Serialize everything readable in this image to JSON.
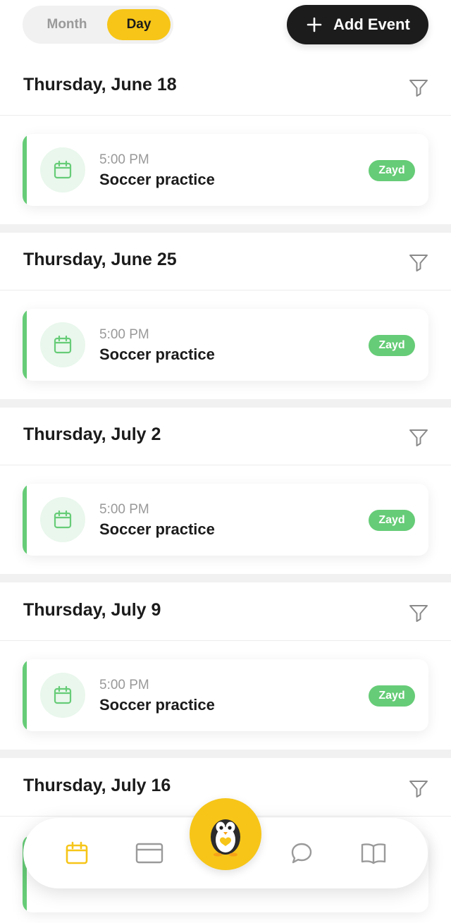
{
  "view_toggle": {
    "month_label": "Month",
    "day_label": "Day",
    "selected": "Day"
  },
  "add_event": {
    "label": "Add Event",
    "icon": "plus-icon"
  },
  "colors": {
    "accent_yellow": "#f6c518",
    "event_green": "#66cc77",
    "dark": "#1c1c1c",
    "muted": "#999999"
  },
  "days": [
    {
      "date": "Thursday, June 18",
      "events": [
        {
          "time": "5:00 PM",
          "title": "Soccer practice",
          "tag": "Zayd"
        }
      ]
    },
    {
      "date": "Thursday, June 25",
      "events": [
        {
          "time": "5:00 PM",
          "title": "Soccer practice",
          "tag": "Zayd"
        }
      ]
    },
    {
      "date": "Thursday, July 2",
      "events": [
        {
          "time": "5:00 PM",
          "title": "Soccer practice",
          "tag": "Zayd"
        }
      ]
    },
    {
      "date": "Thursday, July 9",
      "events": [
        {
          "time": "5:00 PM",
          "title": "Soccer practice",
          "tag": "Zayd"
        }
      ]
    },
    {
      "date": "Thursday, July 16",
      "events": []
    }
  ],
  "bottom_nav": {
    "items": [
      "calendar-icon",
      "card-icon",
      "penguin-icon",
      "chat-bubble-icon",
      "book-icon"
    ],
    "active": "calendar-icon"
  }
}
